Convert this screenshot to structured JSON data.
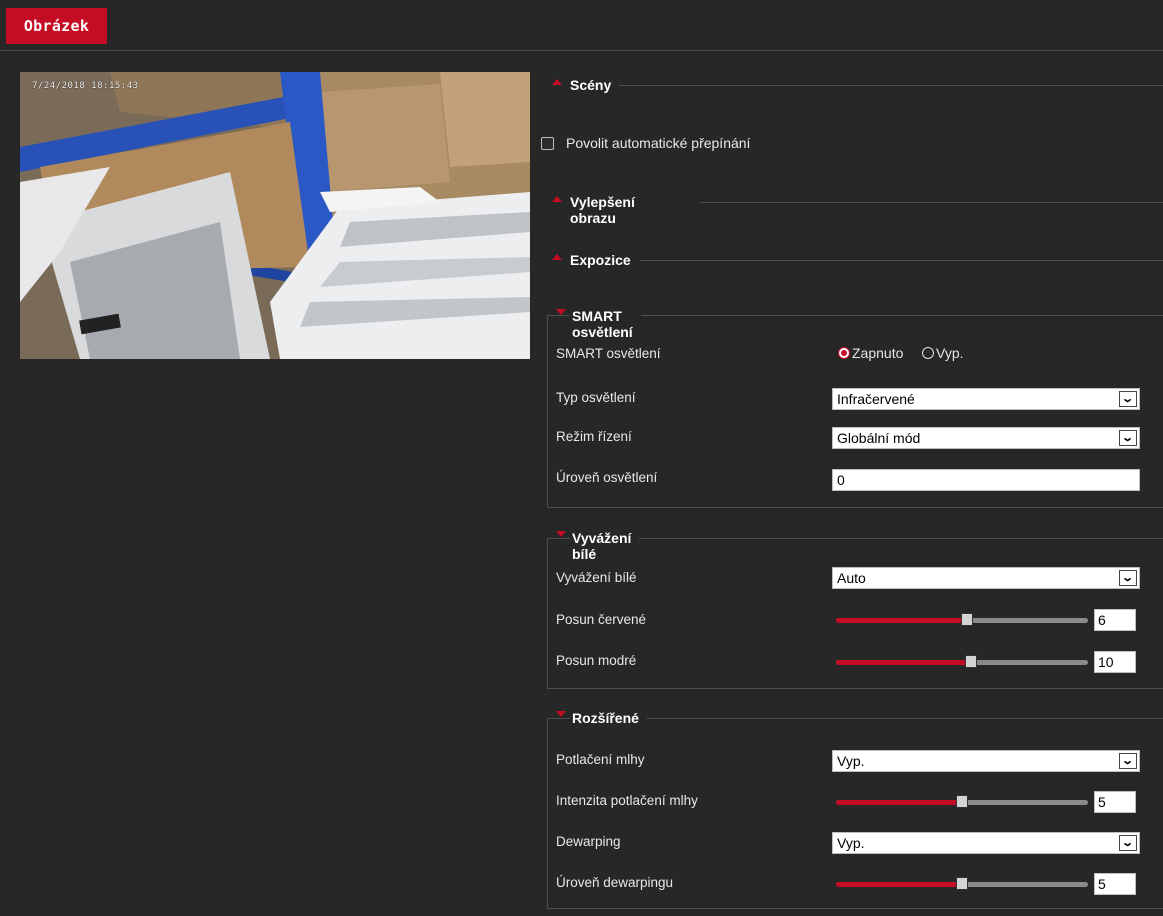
{
  "tab": {
    "title": "Obrázek"
  },
  "preview": {
    "osd_text": "7/24/2018 18:15:43"
  },
  "sections": {
    "scenes": "Scény",
    "enhance": "Vylepšení obrazu",
    "exposure": "Expozice",
    "smart": "SMART osvětlení",
    "wb": "Vyvážení bílé",
    "advanced": "Rozšířené"
  },
  "scenes": {
    "auto_switch_label": "Povolit automatické přepínání",
    "auto_switch_checked": false
  },
  "smart": {
    "label_smart": "SMART osvětlení",
    "radio_on": "Zapnuto",
    "radio_off": "Vyp.",
    "selected": "on",
    "label_type": "Typ osvětlení",
    "type_value": "Infračervené",
    "label_mode": "Režim řízení",
    "mode_value": "Globální mód",
    "label_level": "Úroveň osvětlení",
    "level_value": "0"
  },
  "wb": {
    "label_wb": "Vyvážení bílé",
    "wb_value": "Auto",
    "label_red": "Posun červené",
    "red_value": "6",
    "red_fraction": 0.52,
    "label_blue": "Posun modré",
    "blue_value": "10",
    "blue_fraction": 0.535
  },
  "advanced": {
    "label_defog": "Potlačení mlhy",
    "defog_value": "Vyp.",
    "label_defog_int": "Intenzita potlačení mlhy",
    "defog_int_value": "5",
    "defog_int_fraction": 0.5,
    "label_dewarp": "Dewarping",
    "dewarp_value": "Vyp.",
    "label_dewarp_level": "Úroveň dewarpingu",
    "dewarp_level_value": "5",
    "dewarp_level_fraction": 0.5
  },
  "icons": {
    "expand": "triangle-up-icon",
    "collapse": "triangle-down-icon",
    "dropdown": "chevron-down-icon"
  },
  "colors": {
    "accent": "#c40c25",
    "background": "#272727"
  }
}
